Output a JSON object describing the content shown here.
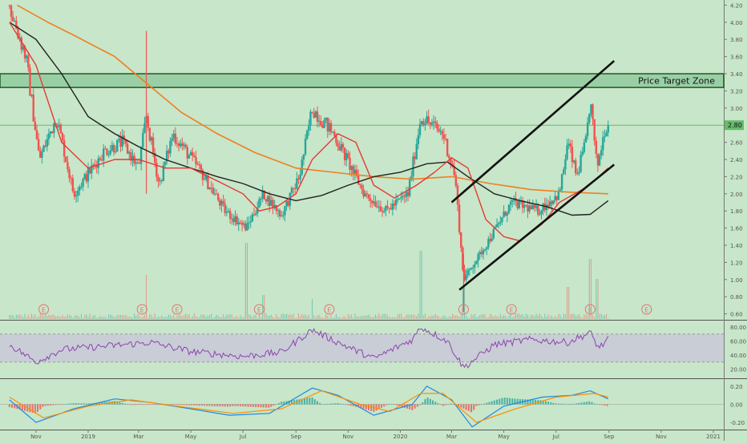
{
  "colors": {
    "background": "#c8e6c9",
    "candle_up": "#26a69a",
    "candle_down": "#ef5350",
    "ma_short": "#e53935",
    "ma_mid": "#212121",
    "ma_long": "#ef7f22",
    "channel": "#111111",
    "zone_fill": "#8bc79a",
    "zone_border": "#1b5e20",
    "price_line": "#66bb6a",
    "rsi_line": "#8e44ad",
    "rsi_band": "#c8c8d8",
    "macd_line": "#1e88e5",
    "signal_line": "#ff8f00",
    "earnings_marker": "#e57373",
    "axis_text": "#555555"
  },
  "chart_data": [
    {
      "type": "candlestick",
      "panel": "price",
      "y_ticks": [
        "4.20",
        "4.00",
        "3.80",
        "3.60",
        "3.40",
        "3.20",
        "3.00",
        "2.80",
        "2.60",
        "2.40",
        "2.20",
        "2.00",
        "1.80",
        "1.60",
        "1.40",
        "1.20",
        "1.00",
        "0.80",
        "0.60"
      ],
      "ylim": [
        0.54,
        4.26
      ],
      "x_labels": [
        "Nov",
        "2019",
        "Mar",
        "May",
        "Jul",
        "Sep",
        "Nov",
        "2020",
        "Mar",
        "May",
        "Jul",
        "Sep",
        "Nov",
        "2021"
      ],
      "current_price_label": "2.80",
      "annotation": "Price Target Zone",
      "target_zone": [
        3.24,
        3.4
      ],
      "earnings_label": "E",
      "key_points": [
        {
          "date": "2018-10-01",
          "price": 4.2
        },
        {
          "date": "2018-10-20",
          "price": 3.6
        },
        {
          "date": "2018-11-05",
          "price": 2.4
        },
        {
          "date": "2018-11-25",
          "price": 2.9
        },
        {
          "date": "2018-12-15",
          "price": 2.0
        },
        {
          "date": "2019-01-20",
          "price": 2.5
        },
        {
          "date": "2019-02-10",
          "price": 2.6
        },
        {
          "date": "2019-03-01",
          "price": 2.3
        },
        {
          "date": "2019-03-10",
          "price": 2.9
        },
        {
          "date": "2019-03-25",
          "price": 2.1
        },
        {
          "date": "2019-04-10",
          "price": 2.7
        },
        {
          "date": "2019-05-10",
          "price": 2.3
        },
        {
          "date": "2019-06-10",
          "price": 1.8
        },
        {
          "date": "2019-07-05",
          "price": 1.6
        },
        {
          "date": "2019-07-25",
          "price": 2.0
        },
        {
          "date": "2019-08-15",
          "price": 1.75
        },
        {
          "date": "2019-09-05",
          "price": 2.2
        },
        {
          "date": "2019-09-20",
          "price": 3.0
        },
        {
          "date": "2019-10-15",
          "price": 2.7
        },
        {
          "date": "2019-11-20",
          "price": 2.0
        },
        {
          "date": "2019-12-15",
          "price": 1.8
        },
        {
          "date": "2020-01-10",
          "price": 2.0
        },
        {
          "date": "2020-01-25",
          "price": 2.9
        },
        {
          "date": "2020-02-20",
          "price": 2.7
        },
        {
          "date": "2020-03-05",
          "price": 2.2
        },
        {
          "date": "2020-03-15",
          "price": 1.0
        },
        {
          "date": "2020-04-10",
          "price": 1.4
        },
        {
          "date": "2020-05-10",
          "price": 1.9
        },
        {
          "date": "2020-06-10",
          "price": 1.8
        },
        {
          "date": "2020-07-05",
          "price": 2.0
        },
        {
          "date": "2020-07-15",
          "price": 2.6
        },
        {
          "date": "2020-07-25",
          "price": 2.2
        },
        {
          "date": "2020-08-05",
          "price": 2.6
        },
        {
          "date": "2020-08-10",
          "price": 3.1
        },
        {
          "date": "2020-08-18",
          "price": 2.3
        },
        {
          "date": "2020-08-28",
          "price": 2.8
        }
      ],
      "ma_short": [
        {
          "date": "2018-10-01",
          "price": 4.0
        },
        {
          "date": "2018-11-01",
          "price": 3.5
        },
        {
          "date": "2018-12-01",
          "price": 2.6
        },
        {
          "date": "2019-01-01",
          "price": 2.3
        },
        {
          "date": "2019-02-01",
          "price": 2.4
        },
        {
          "date": "2019-03-01",
          "price": 2.4
        },
        {
          "date": "2019-04-01",
          "price": 2.3
        },
        {
          "date": "2019-05-01",
          "price": 2.3
        },
        {
          "date": "2019-06-01",
          "price": 2.15
        },
        {
          "date": "2019-07-01",
          "price": 2.0
        },
        {
          "date": "2019-07-20",
          "price": 1.8
        },
        {
          "date": "2019-08-10",
          "price": 1.85
        },
        {
          "date": "2019-09-01",
          "price": 2.0
        },
        {
          "date": "2019-09-20",
          "price": 2.4
        },
        {
          "date": "2019-10-20",
          "price": 2.7
        },
        {
          "date": "2019-11-10",
          "price": 2.6
        },
        {
          "date": "2019-12-01",
          "price": 2.1
        },
        {
          "date": "2019-12-25",
          "price": 1.95
        },
        {
          "date": "2020-01-20",
          "price": 2.1
        },
        {
          "date": "2020-02-10",
          "price": 2.25
        },
        {
          "date": "2020-03-01",
          "price": 2.42
        },
        {
          "date": "2020-03-20",
          "price": 2.3
        },
        {
          "date": "2020-04-10",
          "price": 1.7
        },
        {
          "date": "2020-05-01",
          "price": 1.5
        },
        {
          "date": "2020-05-20",
          "price": 1.45
        },
        {
          "date": "2020-06-15",
          "price": 1.65
        },
        {
          "date": "2020-07-05",
          "price": 1.9
        },
        {
          "date": "2020-08-01",
          "price": 2.05
        },
        {
          "date": "2020-08-20",
          "price": 2.2
        },
        {
          "date": "2020-08-31",
          "price": 2.3
        }
      ],
      "ma_mid": [
        {
          "date": "2018-10-01",
          "price": 4.0
        },
        {
          "date": "2018-11-01",
          "price": 3.8
        },
        {
          "date": "2018-12-01",
          "price": 3.4
        },
        {
          "date": "2019-01-01",
          "price": 2.9
        },
        {
          "date": "2019-02-01",
          "price": 2.7
        },
        {
          "date": "2019-03-01",
          "price": 2.55
        },
        {
          "date": "2019-04-01",
          "price": 2.4
        },
        {
          "date": "2019-05-01",
          "price": 2.3
        },
        {
          "date": "2019-06-01",
          "price": 2.2
        },
        {
          "date": "2019-07-01",
          "price": 2.12
        },
        {
          "date": "2019-08-01",
          "price": 2.0
        },
        {
          "date": "2019-09-01",
          "price": 1.92
        },
        {
          "date": "2019-10-01",
          "price": 1.98
        },
        {
          "date": "2019-11-01",
          "price": 2.1
        },
        {
          "date": "2019-12-01",
          "price": 2.2
        },
        {
          "date": "2020-01-01",
          "price": 2.25
        },
        {
          "date": "2020-02-01",
          "price": 2.35
        },
        {
          "date": "2020-02-25",
          "price": 2.37
        },
        {
          "date": "2020-03-20",
          "price": 2.2
        },
        {
          "date": "2020-04-20",
          "price": 2.0
        },
        {
          "date": "2020-05-20",
          "price": 1.92
        },
        {
          "date": "2020-06-20",
          "price": 1.85
        },
        {
          "date": "2020-07-20",
          "price": 1.75
        },
        {
          "date": "2020-08-10",
          "price": 1.76
        },
        {
          "date": "2020-08-31",
          "price": 1.92
        }
      ],
      "ma_long": [
        {
          "date": "2018-10-10",
          "price": 4.2
        },
        {
          "date": "2018-11-15",
          "price": 4.0
        },
        {
          "date": "2018-12-15",
          "price": 3.85
        },
        {
          "date": "2019-02-01",
          "price": 3.6
        },
        {
          "date": "2019-03-15",
          "price": 3.25
        },
        {
          "date": "2019-04-20",
          "price": 2.95
        },
        {
          "date": "2019-06-01",
          "price": 2.7
        },
        {
          "date": "2019-07-15",
          "price": 2.48
        },
        {
          "date": "2019-09-01",
          "price": 2.3
        },
        {
          "date": "2019-10-15",
          "price": 2.25
        },
        {
          "date": "2019-12-01",
          "price": 2.2
        },
        {
          "date": "2020-01-15",
          "price": 2.17
        },
        {
          "date": "2020-03-01",
          "price": 2.2
        },
        {
          "date": "2020-04-15",
          "price": 2.12
        },
        {
          "date": "2020-06-01",
          "price": 2.05
        },
        {
          "date": "2020-07-15",
          "price": 2.02
        },
        {
          "date": "2020-08-31",
          "price": 2.0
        }
      ],
      "channel_upper": [
        {
          "date": "2020-03-01",
          "price": 1.9
        },
        {
          "date": "2020-09-07",
          "price": 3.55
        }
      ],
      "channel_lower": [
        {
          "date": "2020-03-10",
          "price": 0.88
        },
        {
          "date": "2020-09-07",
          "price": 2.34
        }
      ],
      "earnings_dates": [
        "2018-11-10",
        "2019-03-05",
        "2019-04-15",
        "2019-07-20",
        "2019-10-10",
        "2020-03-15",
        "2020-05-10",
        "2020-08-10",
        "2020-10-15"
      ]
    },
    {
      "type": "line",
      "panel": "rsi",
      "y_ticks": [
        "80.00",
        "60.00",
        "40.00",
        "20.00"
      ],
      "ylim": [
        8,
        88
      ],
      "band": [
        30,
        70
      ],
      "key_points": [
        {
          "date": "2018-10-01",
          "value": 55
        },
        {
          "date": "2018-11-01",
          "value": 30
        },
        {
          "date": "2018-12-01",
          "value": 48
        },
        {
          "date": "2019-01-15",
          "value": 52
        },
        {
          "date": "2019-03-15",
          "value": 58
        },
        {
          "date": "2019-05-01",
          "value": 45
        },
        {
          "date": "2019-07-01",
          "value": 38
        },
        {
          "date": "2019-08-15",
          "value": 44
        },
        {
          "date": "2019-09-20",
          "value": 76
        },
        {
          "date": "2019-10-20",
          "value": 58
        },
        {
          "date": "2019-12-01",
          "value": 35
        },
        {
          "date": "2020-01-15",
          "value": 62
        },
        {
          "date": "2020-01-25",
          "value": 80
        },
        {
          "date": "2020-02-25",
          "value": 60
        },
        {
          "date": "2020-03-15",
          "value": 22
        },
        {
          "date": "2020-04-20",
          "value": 55
        },
        {
          "date": "2020-06-01",
          "value": 62
        },
        {
          "date": "2020-07-15",
          "value": 58
        },
        {
          "date": "2020-08-10",
          "value": 72
        },
        {
          "date": "2020-08-20",
          "value": 50
        },
        {
          "date": "2020-08-31",
          "value": 62
        }
      ]
    },
    {
      "type": "macd",
      "panel": "macd",
      "y_ticks": [
        "0.20",
        "0.00",
        "-0.20"
      ],
      "ylim": [
        -0.27,
        0.27
      ],
      "macd_points": [
        {
          "date": "2018-10-01",
          "value": 0.05
        },
        {
          "date": "2018-11-01",
          "value": -0.2
        },
        {
          "date": "2018-12-15",
          "value": -0.05
        },
        {
          "date": "2019-02-01",
          "value": 0.06
        },
        {
          "date": "2019-03-15",
          "value": 0.02
        },
        {
          "date": "2019-05-01",
          "value": -0.05
        },
        {
          "date": "2019-06-15",
          "value": -0.12
        },
        {
          "date": "2019-08-01",
          "value": -0.1
        },
        {
          "date": "2019-09-20",
          "value": 0.18
        },
        {
          "date": "2019-10-20",
          "value": 0.1
        },
        {
          "date": "2019-12-01",
          "value": -0.12
        },
        {
          "date": "2020-01-15",
          "value": 0.0
        },
        {
          "date": "2020-02-01",
          "value": 0.2
        },
        {
          "date": "2020-03-01",
          "value": 0.05
        },
        {
          "date": "2020-03-25",
          "value": -0.25
        },
        {
          "date": "2020-05-01",
          "value": -0.02
        },
        {
          "date": "2020-06-15",
          "value": 0.08
        },
        {
          "date": "2020-07-20",
          "value": 0.1
        },
        {
          "date": "2020-08-10",
          "value": 0.15
        },
        {
          "date": "2020-08-31",
          "value": 0.06
        }
      ],
      "signal_points": [
        {
          "date": "2018-10-01",
          "value": 0.08
        },
        {
          "date": "2018-11-10",
          "value": -0.15
        },
        {
          "date": "2019-01-01",
          "value": -0.02
        },
        {
          "date": "2019-02-20",
          "value": 0.05
        },
        {
          "date": "2019-04-15",
          "value": -0.02
        },
        {
          "date": "2019-06-20",
          "value": -0.1
        },
        {
          "date": "2019-08-15",
          "value": -0.05
        },
        {
          "date": "2019-10-01",
          "value": 0.15
        },
        {
          "date": "2019-11-15",
          "value": 0.0
        },
        {
          "date": "2019-12-20",
          "value": -0.08
        },
        {
          "date": "2020-01-25",
          "value": 0.12
        },
        {
          "date": "2020-02-20",
          "value": 0.12
        },
        {
          "date": "2020-03-30",
          "value": -0.2
        },
        {
          "date": "2020-05-15",
          "value": -0.05
        },
        {
          "date": "2020-07-01",
          "value": 0.08
        },
        {
          "date": "2020-08-15",
          "value": 0.12
        },
        {
          "date": "2020-08-31",
          "value": 0.08
        }
      ]
    }
  ]
}
